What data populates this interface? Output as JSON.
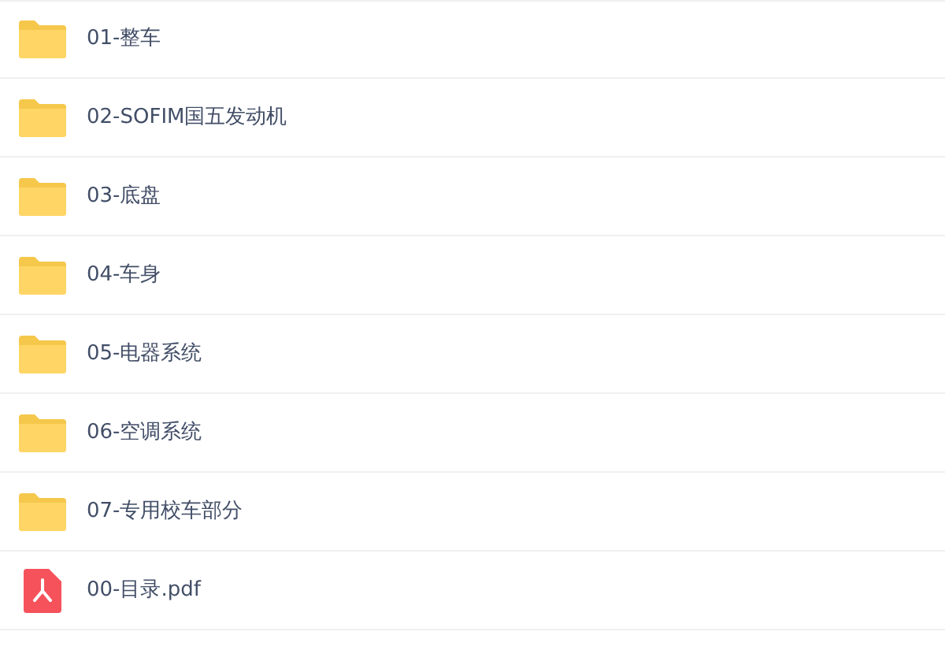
{
  "files": [
    {
      "kind": "folder",
      "name": "01-整车"
    },
    {
      "kind": "folder",
      "name": "02-SOFIM国五发动机"
    },
    {
      "kind": "folder",
      "name": "03-底盘"
    },
    {
      "kind": "folder",
      "name": "04-车身"
    },
    {
      "kind": "folder",
      "name": "05-电器系统"
    },
    {
      "kind": "folder",
      "name": "06-空调系统"
    },
    {
      "kind": "folder",
      "name": "07-专用校车部分"
    },
    {
      "kind": "pdf",
      "name": "00-目录.pdf"
    }
  ]
}
